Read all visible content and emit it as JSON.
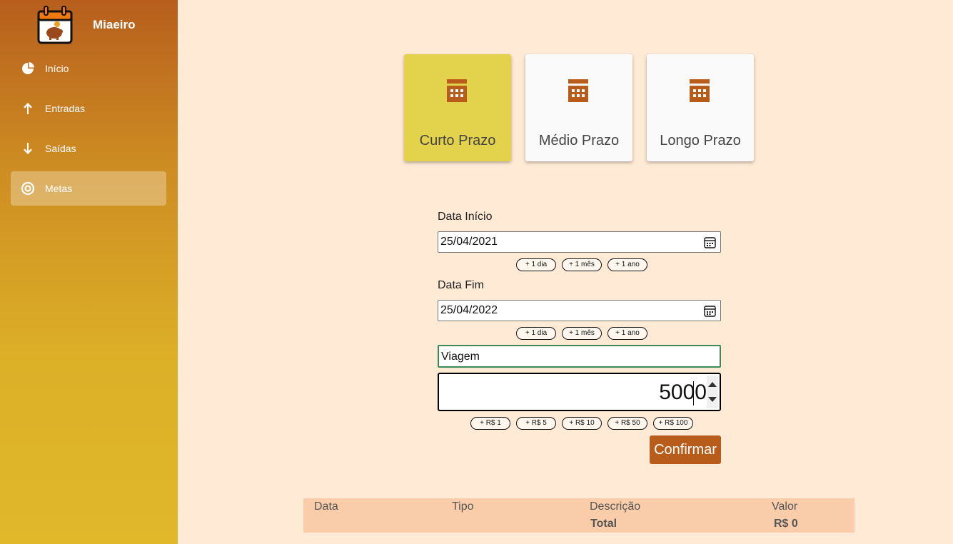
{
  "app": {
    "name": "Miaeiro"
  },
  "sidebar": {
    "items": [
      {
        "label": "Início",
        "icon": "pie-chart-icon"
      },
      {
        "label": "Entradas",
        "icon": "arrow-up-icon"
      },
      {
        "label": "Saídas",
        "icon": "arrow-down-icon"
      },
      {
        "label": "Metas",
        "icon": "target-icon",
        "active": true
      }
    ]
  },
  "terms": [
    {
      "label": "Curto Prazo",
      "icon": "calendar-icon",
      "selected": true
    },
    {
      "label": "Médio Prazo",
      "icon": "calendar-icon",
      "selected": false
    },
    {
      "label": "Longo Prazo",
      "icon": "calendar-icon",
      "selected": false
    }
  ],
  "form": {
    "start_label": "Data Início",
    "start_value": "25/04/2021",
    "end_label": "Data Fim",
    "end_value": "25/04/2022",
    "date_shortcuts": [
      "+ 1 dia",
      "+ 1 mês",
      "+ 1 ano"
    ],
    "description_value": "Viagem",
    "amount_value": "5000",
    "amount_shortcuts": [
      "+ R$ 1",
      "+ R$ 5",
      "+ R$ 10",
      "+ R$ 50",
      "+ R$ 100"
    ],
    "confirm_label": "Confirmar"
  },
  "table": {
    "headers": [
      "Data",
      "Tipo",
      "Descrição",
      "Valor"
    ],
    "total_label": "Total",
    "total_value": "R$ 0"
  },
  "colors": {
    "sidebar_top": "#b75e1d",
    "sidebar_bottom": "#e0b82a",
    "background": "#ffead5",
    "selected_card": "#e3d24c",
    "accent": "#b85c1c",
    "table_bg": "#f9cdaa"
  }
}
